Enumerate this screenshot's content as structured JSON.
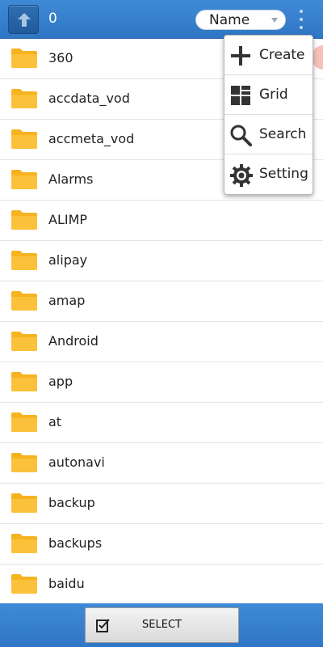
{
  "header": {
    "item_count": "0",
    "sort_selected": "Name"
  },
  "folders": [
    {
      "name": "360"
    },
    {
      "name": "accdata_vod"
    },
    {
      "name": "accmeta_vod"
    },
    {
      "name": "Alarms"
    },
    {
      "name": "ALIMP"
    },
    {
      "name": "alipay"
    },
    {
      "name": "amap"
    },
    {
      "name": "Android"
    },
    {
      "name": "app"
    },
    {
      "name": "at"
    },
    {
      "name": "autonavi"
    },
    {
      "name": "backup"
    },
    {
      "name": "backups"
    },
    {
      "name": "baidu"
    }
  ],
  "menu": {
    "items": [
      {
        "label": "Create",
        "icon": "plus-icon"
      },
      {
        "label": "Grid",
        "icon": "grid-icon"
      },
      {
        "label": "Search",
        "icon": "search-icon"
      },
      {
        "label": "Setting",
        "icon": "gear-icon"
      }
    ]
  },
  "footer": {
    "select_label": "SELECT"
  },
  "colors": {
    "bar": "#3a84d0",
    "folder": "#f7b21f"
  }
}
